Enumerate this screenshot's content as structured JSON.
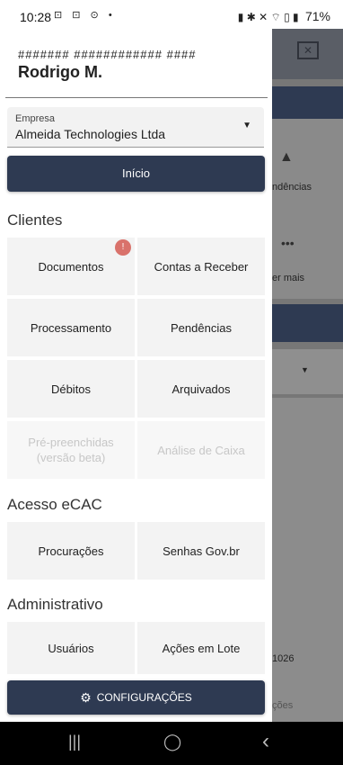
{
  "status": {
    "time": "10:28",
    "left_icons": "⊡ ⊡ ⊙ •",
    "right_icons": "▮ ✱ ✕ ⌔ ▯ ▮",
    "battery": "71%"
  },
  "background": {
    "pendencias_fragment": "ndências",
    "ver_mais_fragment": "er mais",
    "number_fragment": "1026",
    "bottom_fragment": "ções"
  },
  "drawer": {
    "masked_id": "####### ############ ####",
    "user_name": "Rodrigo M.",
    "company": {
      "label": "Empresa",
      "value": "Almeida Technologies Ltda"
    },
    "home_button": "Início",
    "sections": {
      "clientes": "Clientes",
      "ecac": "Acesso eCAC",
      "admin": "Administrativo"
    },
    "tiles": {
      "documentos": "Documentos",
      "contas_receber": "Contas a Receber",
      "processamento": "Processamento",
      "pendencias": "Pendências",
      "debitos": "Débitos",
      "arquivados": "Arquivados",
      "pre_preenchidas_1": "Pré-preenchidas",
      "pre_preenchidas_2": "(versão beta)",
      "analise_caixa": "Análise de Caixa",
      "procuracoes": "Procurações",
      "senhas_govbr": "Senhas Gov.br",
      "usuarios": "Usuários",
      "acoes_lote": "Ações em Lote"
    },
    "documentos_badge": "!",
    "settings_button": "CONFIGURAÇÕES"
  },
  "navbar": {
    "recents": "|||",
    "home": "◯",
    "back": "‹"
  }
}
